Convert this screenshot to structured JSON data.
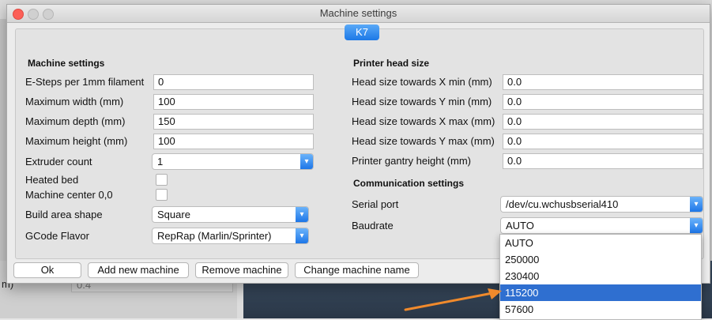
{
  "window": {
    "title": "Machine settings",
    "tab": "K7"
  },
  "background": {
    "label": "m)",
    "field_value": "0.4"
  },
  "machine": {
    "heading": "Machine settings",
    "rows": [
      {
        "label": "E-Steps per 1mm filament",
        "value": "0"
      },
      {
        "label": "Maximum width (mm)",
        "value": "100"
      },
      {
        "label": "Maximum depth (mm)",
        "value": "150"
      },
      {
        "label": "Maximum height (mm)",
        "value": "100"
      }
    ],
    "extruder_label": "Extruder count",
    "extruder_value": "1",
    "heated_bed_label": "Heated bed",
    "center_label": "Machine center 0,0",
    "build_area_label": "Build area shape",
    "build_area_value": "Square",
    "gcode_label": "GCode Flavor",
    "gcode_value": "RepRap (Marlin/Sprinter)"
  },
  "head": {
    "heading": "Printer head size",
    "rows": [
      {
        "label": "Head size towards X min (mm)",
        "value": "0.0"
      },
      {
        "label": "Head size towards Y min (mm)",
        "value": "0.0"
      },
      {
        "label": "Head size towards X max (mm)",
        "value": "0.0"
      },
      {
        "label": "Head size towards Y max (mm)",
        "value": "0.0"
      },
      {
        "label": "Printer gantry height (mm)",
        "value": "0.0"
      }
    ]
  },
  "comm": {
    "heading": "Communication settings",
    "serial_label": "Serial port",
    "serial_value": "/dev/cu.wchusbserial410",
    "baud_label": "Baudrate",
    "baud_value": "AUTO",
    "baud_options": [
      "AUTO",
      "250000",
      "230400",
      "115200",
      "57600"
    ],
    "highlighted": "115200"
  },
  "buttons": {
    "ok": "Ok",
    "add": "Add new machine",
    "remove": "Remove machine",
    "rename": "Change machine name"
  },
  "colors": {
    "accent": "#1c78e6",
    "highlight": "#2f6fd0",
    "arrow": "#f08a2c"
  },
  "icons": {
    "select_arrow": "chevron-down-icon",
    "annotation": "arrow-icon"
  }
}
